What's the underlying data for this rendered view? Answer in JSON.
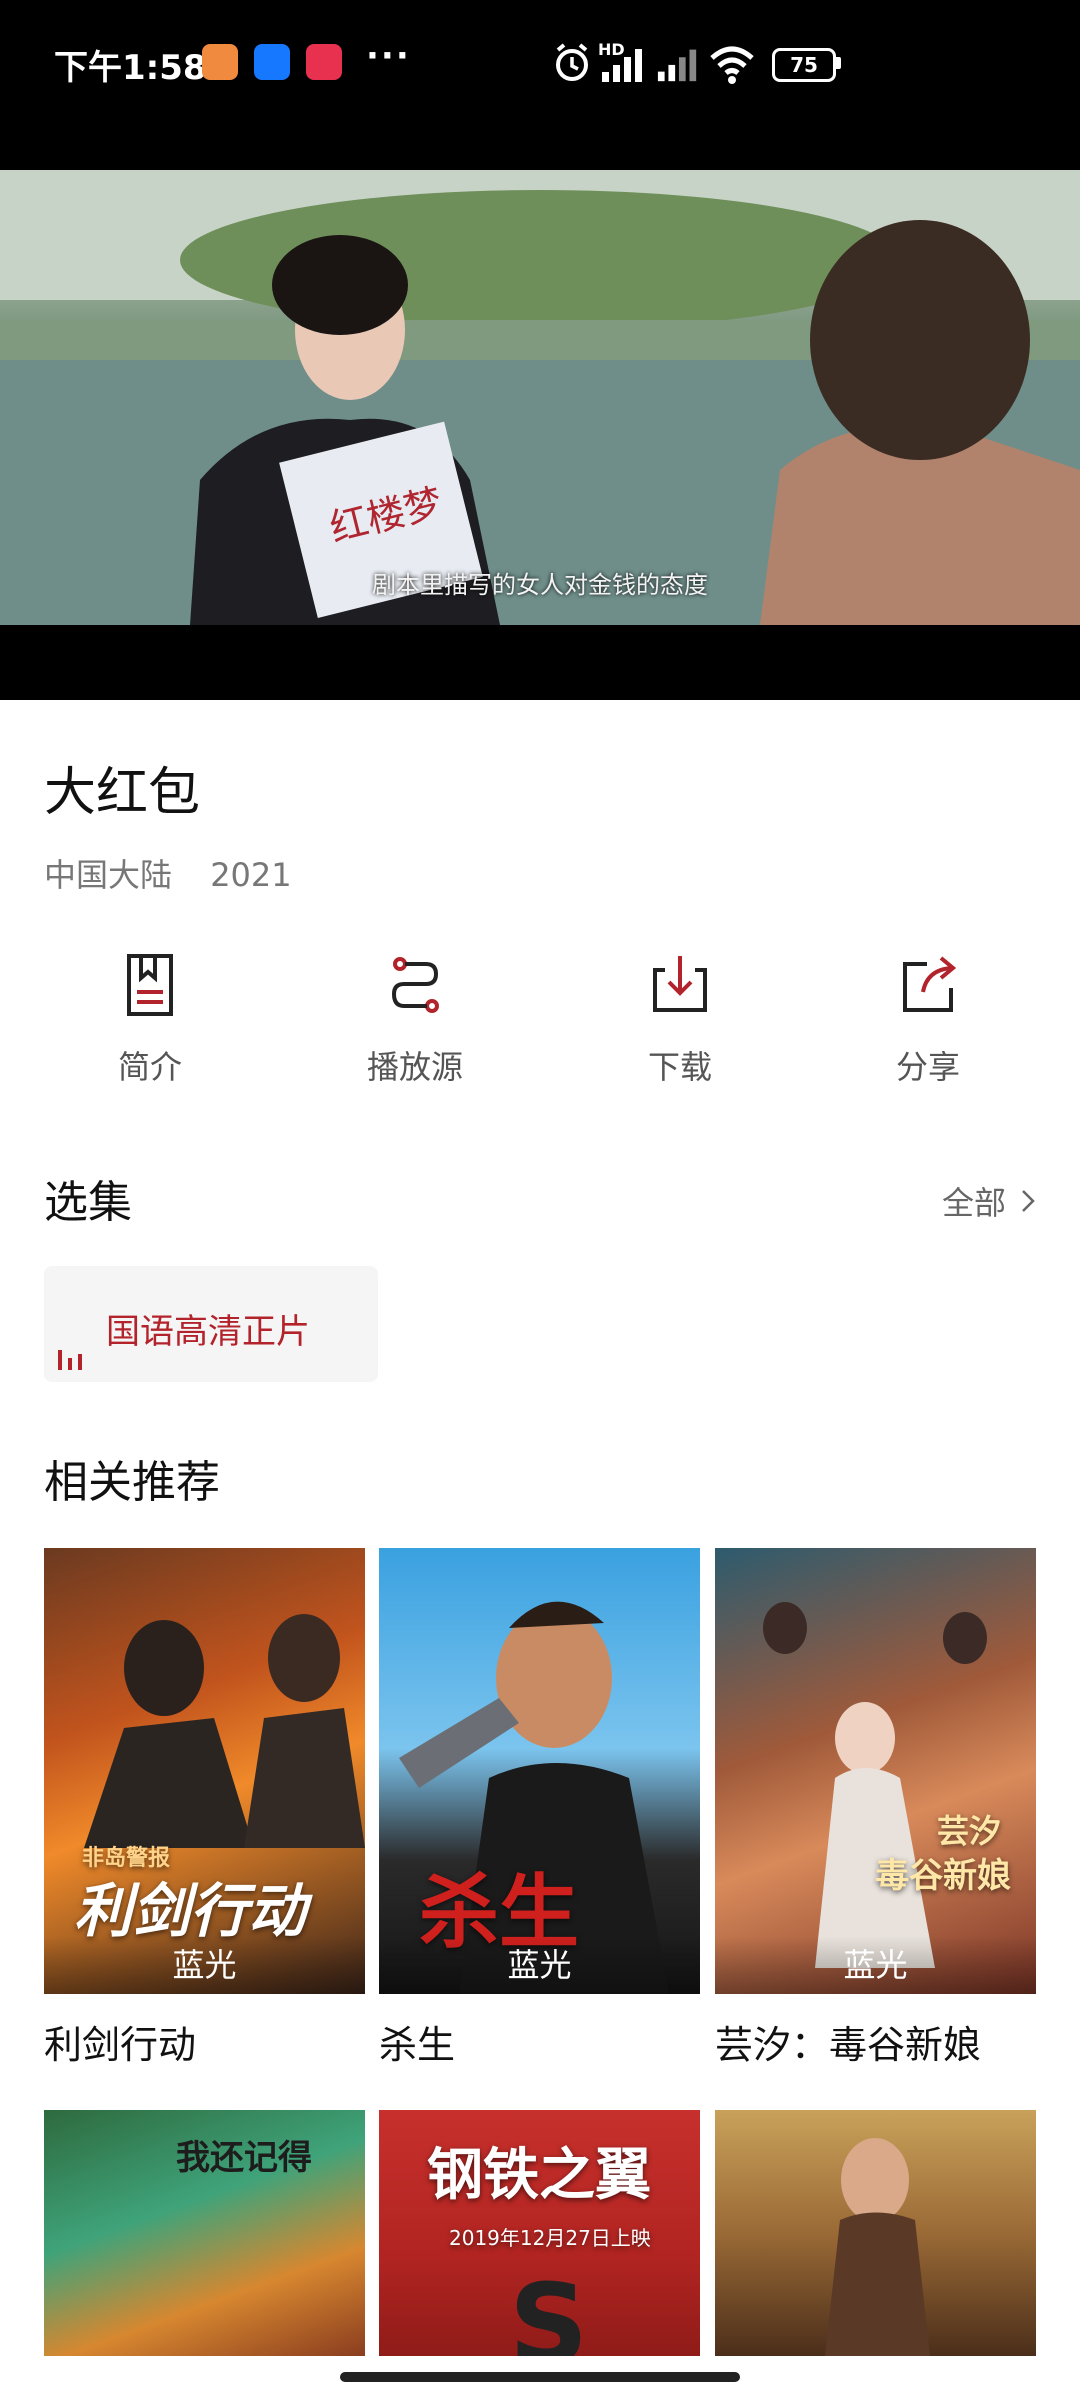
{
  "status_bar": {
    "time": "下午1:58",
    "more": "···",
    "battery": "75",
    "network": "HD"
  },
  "video": {
    "subtitle": "剧本里描写的女人对金钱的态度",
    "book_title": "红楼梦"
  },
  "movie": {
    "title": "大红包",
    "region": "中国大陆",
    "year": "2021"
  },
  "actions": [
    {
      "label": "简介",
      "icon": "book-icon"
    },
    {
      "label": "播放源",
      "icon": "route-icon"
    },
    {
      "label": "下载",
      "icon": "download-icon"
    },
    {
      "label": "分享",
      "icon": "share-icon"
    }
  ],
  "episodes": {
    "header": "选集",
    "all_label": "全部",
    "items": [
      {
        "label": "国语高清正片",
        "active": true
      }
    ]
  },
  "recommend": {
    "header": "相关推荐",
    "items": [
      {
        "title": "利剑行动",
        "badge": "蓝光",
        "poster_text": "利剑行动",
        "poster_sub": "非岛警报"
      },
      {
        "title": "杀生",
        "badge": "蓝光",
        "poster_text": "杀生"
      },
      {
        "title": "芸汐：毒谷新娘",
        "badge": "蓝光",
        "poster_text": "毒谷新娘",
        "poster_sub": "芸汐"
      },
      {
        "title": "",
        "badge": "",
        "poster_text": "我还记得"
      },
      {
        "title": "",
        "badge": "",
        "poster_text": "钢铁之翼",
        "poster_sub": "2019年12月27日上映"
      },
      {
        "title": "",
        "badge": "",
        "poster_text": ""
      }
    ]
  },
  "colors": {
    "accent": "#b3232b",
    "text": "#111111",
    "muted": "#777777"
  }
}
